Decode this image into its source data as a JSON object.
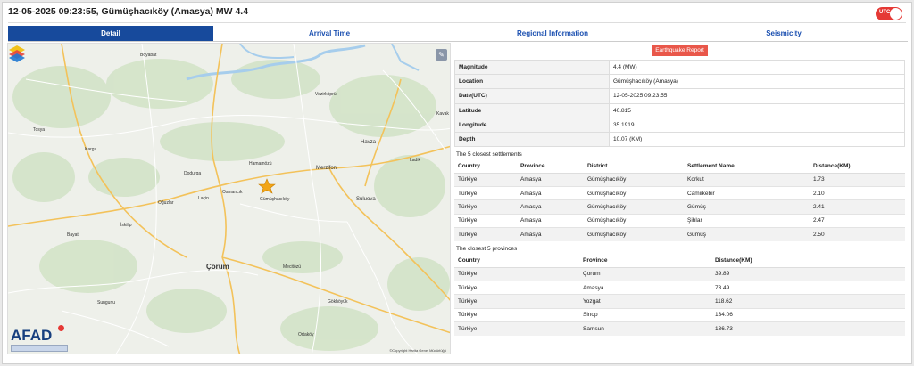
{
  "header": {
    "title": "12-05-2025 09:23:55, Gümüşhacıköy (Amasya) MW 4.4",
    "toggle_label": "UTC"
  },
  "tabs": [
    "Detail",
    "Arrival Time",
    "Regional Information",
    "Seismicity"
  ],
  "map": {
    "labels": {
      "corum": "Çorum",
      "merzifon": "Merzifon",
      "suluova": "Suluova",
      "vezirkopru": "Vezirköprü",
      "havza": "Havza",
      "ladik": "Ladik",
      "dodurga": "Dodurga",
      "lacin": "Laçin",
      "osmancik": "Osmancık",
      "oguzlar": "Oğuzlar",
      "iskilip": "İskilip",
      "bayat": "Bayat",
      "mecitozu": "Mecitözü",
      "gokhoyuk": "Gökhöyük",
      "ortakoy": "Ortaköy",
      "kargi": "Kargı",
      "tosya": "Tosya",
      "boyabat": "Boyabat",
      "gumushacikoy": "Gümüşhacıköy",
      "hamamozu": "Hamamözü",
      "sungurlu": "Sungurlu",
      "kavak": "Kavak"
    },
    "logo": "AFAD",
    "copyright": "©Copyright Harita Genel Müdürlüğü"
  },
  "report_button": "Earthquake Report",
  "info": [
    {
      "key": "Magnitude",
      "value": "4.4 (MW)"
    },
    {
      "key": "Location",
      "value": "Gümüşhacıköy (Amasya)"
    },
    {
      "key": "Date(UTC)",
      "value": "12-05-2025 09:23:55"
    },
    {
      "key": "Latitude",
      "value": "40.815"
    },
    {
      "key": "Longitude",
      "value": "35.1919"
    },
    {
      "key": "Depth",
      "value": "10.07 (KM)"
    }
  ],
  "settlements": {
    "title": "The 5 closest settlements",
    "headers": [
      "Country",
      "Province",
      "District",
      "Settlement Name",
      "Distance(KM)"
    ],
    "rows": [
      [
        "Türkiye",
        "Amasya",
        "Gümüşhacıköy",
        "Korkut",
        "1.73"
      ],
      [
        "Türkiye",
        "Amasya",
        "Gümüşhacıköy",
        "Camiikebir",
        "2.10"
      ],
      [
        "Türkiye",
        "Amasya",
        "Gümüşhacıköy",
        "Gümüş",
        "2.41"
      ],
      [
        "Türkiye",
        "Amasya",
        "Gümüşhacıköy",
        "Şihlar",
        "2.47"
      ],
      [
        "Türkiye",
        "Amasya",
        "Gümüşhacıköy",
        "Gümüş",
        "2.50"
      ]
    ]
  },
  "provinces": {
    "title": "The closest 5 provinces",
    "headers": [
      "Country",
      "Province",
      "Distance(KM)"
    ],
    "rows": [
      [
        "Türkiye",
        "Çorum",
        "39.89"
      ],
      [
        "Türkiye",
        "Amasya",
        "73.49"
      ],
      [
        "Türkiye",
        "Yozgat",
        "118.62"
      ],
      [
        "Türkiye",
        "Sinop",
        "134.06"
      ],
      [
        "Türkiye",
        "Samsun",
        "136.73"
      ]
    ]
  },
  "colors": {
    "tab_active": "#174a9c",
    "toggle": "#e53935",
    "report": "#e9574a",
    "star": "#f2a516"
  }
}
